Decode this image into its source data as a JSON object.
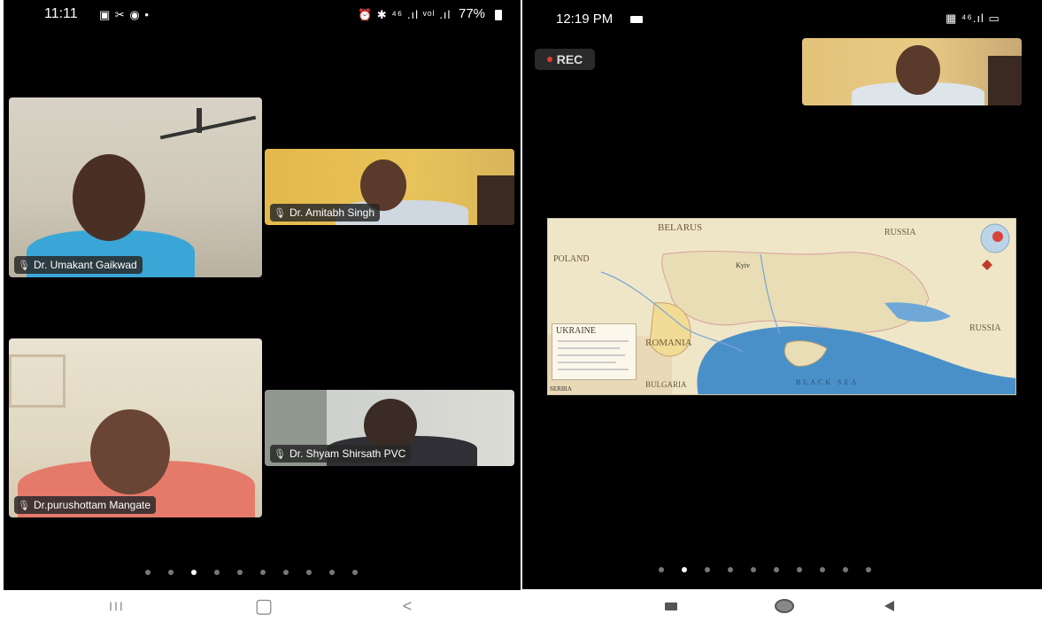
{
  "left_phone": {
    "status": {
      "time": "11:11",
      "icons_left": "▣ ✂ ◉ •",
      "icons_right": "⏰ ✱ ⁴⁶ .ıl ᵛᵒˡ .ıl",
      "battery": "77%"
    },
    "participants": [
      {
        "name": "Dr. Umakant Gaikwad"
      },
      {
        "name": "Dr. Amitabh Singh"
      },
      {
        "name": "Dr.purushottam Mangate"
      },
      {
        "name": "Dr. Shyam Shirsath PVC"
      }
    ],
    "pager": {
      "count": 10,
      "active_index": 2
    },
    "nav": {
      "recents": "III",
      "home": "▢",
      "back": "<"
    }
  },
  "right_phone": {
    "status": {
      "time": "12:19 PM",
      "icons_right": "▦ ⁴⁶.ıl ▭"
    },
    "rec_label": "REC",
    "map": {
      "labels": {
        "belarus": "BELARUS",
        "russia_top": "RUSSIA",
        "poland": "POLAND",
        "russia_right": "RUSSIA",
        "ukraine": "UKRAINE",
        "romania": "ROMANIA",
        "bulgaria": "BULGARIA",
        "black_sea": "BLACK SEA",
        "kyiv": "Kyiv",
        "serbia": "SERBIA"
      }
    },
    "pager": {
      "count": 10,
      "active_index": 1
    }
  },
  "colors": {
    "background": "#000000",
    "name_tag_bg": "#282828",
    "rec_dot": "#e53935",
    "map_land": "#efe6c8",
    "map_sea": "#4a90c8"
  }
}
